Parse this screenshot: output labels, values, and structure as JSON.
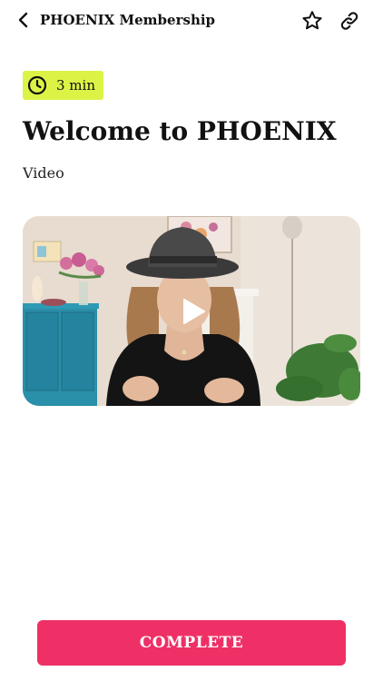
{
  "header": {
    "title": "PHOENIX Membership",
    "back_icon": "chevron-left-icon",
    "favorite_icon": "star-icon",
    "share_icon": "link-icon"
  },
  "lesson": {
    "duration": "3 min",
    "duration_icon": "clock-icon",
    "title": "Welcome to PHOENIX",
    "content_type": "Video"
  },
  "video": {
    "play_icon": "play-icon"
  },
  "actions": {
    "complete_label": "COMPLETE"
  },
  "colors": {
    "badge_background": "#dcf346",
    "complete_button": "#ee3066",
    "text": "#111111"
  }
}
